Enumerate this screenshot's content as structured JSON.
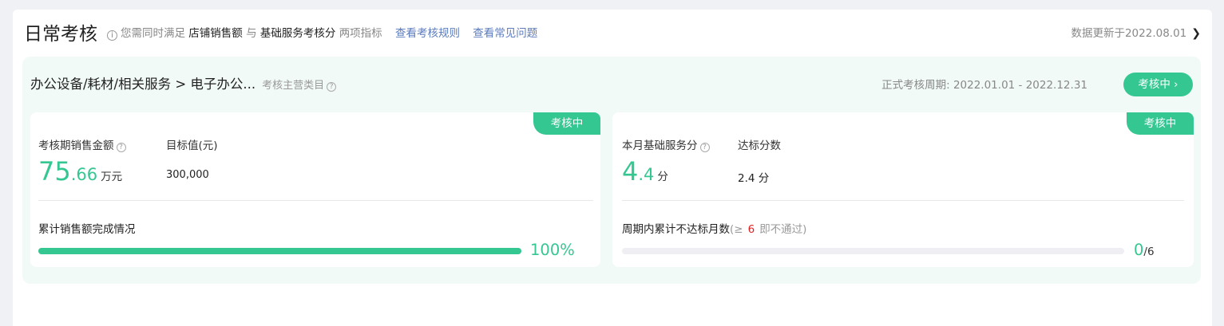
{
  "header": {
    "title": "日常考核",
    "tip_prefix": "您需同时满足",
    "tip_metric1": "店铺销售额",
    "tip_and": "与",
    "tip_metric2": "基础服务考核分",
    "tip_suffix": "两项指标",
    "link_rules": "查看考核规则",
    "link_faq": "查看常见问题",
    "update_text": "数据更新于2022.08.01"
  },
  "category": {
    "name": "办公设备/耗材/相关服务 > 电子办公...",
    "sub_label": "考核主营类目",
    "period": "正式考核周期: 2022.01.01 - 2022.12.31",
    "status_button": "考核中"
  },
  "sales_card": {
    "tag": "考核中",
    "label": "考核期销售金额",
    "value_int": "75",
    "value_dec": ".66",
    "value_unit": "万元",
    "target_label": "目标值(元)",
    "target_value": "300,000",
    "progress_label": "累计销售额完成情况",
    "progress_percent": 100,
    "progress_text": "100%"
  },
  "service_card": {
    "tag": "考核中",
    "label": "本月基础服务分",
    "value_int": "4",
    "value_dec": ".4",
    "value_unit": "分",
    "target_label": "达标分数",
    "target_value": "2.4 分",
    "months_label": "周期内累计不达标月数",
    "months_note_prefix": "(≥",
    "months_threshold": "6",
    "months_note_suffix": "即不通过)",
    "progress_percent": 0,
    "progress_current": "0",
    "progress_total": "/6"
  },
  "colors": {
    "accent": "#35c792",
    "link": "#5b7bbd",
    "warning": "#e02020"
  }
}
